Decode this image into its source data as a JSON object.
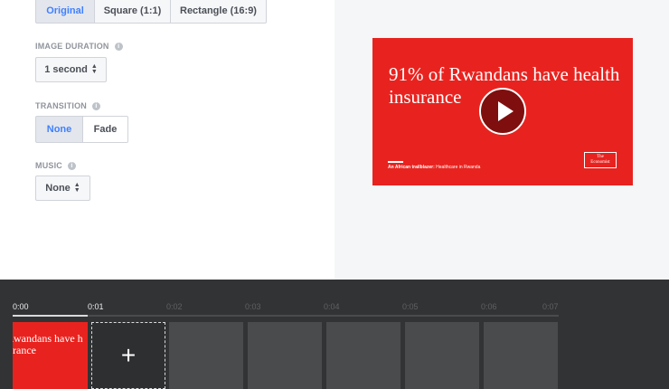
{
  "format": {
    "options": [
      "Original",
      "Square (1:1)",
      "Rectangle (16:9)"
    ],
    "selected": "Original"
  },
  "image_duration": {
    "label": "IMAGE DURATION",
    "value": "1 second"
  },
  "transition": {
    "label": "TRANSITION",
    "options": [
      "None",
      "Fade"
    ],
    "selected": "None"
  },
  "music": {
    "label": "MUSIC",
    "value": "None"
  },
  "preview": {
    "headline": "91% of Rwandans have health insurance",
    "subtitle_bold": "An African trailblazer:",
    "subtitle_rest": " Healthcare in Rwanda",
    "logo_line1": "The",
    "logo_line2": "Economist"
  },
  "timeline": {
    "ticks": [
      "0:00",
      "0:01",
      "0:02",
      "0:03",
      "0:04",
      "0:05",
      "0:06",
      "0:07"
    ],
    "thumbnail_text": "of Rwandans have h insurance",
    "add_label": "+"
  },
  "colors": {
    "accent": "#4080ff",
    "card_red": "#e8231f",
    "timeline_bg": "#323334"
  },
  "icons": {
    "info": "info-icon",
    "dropdown": "up-down-chevron-icon",
    "play": "play-icon",
    "add": "plus-icon"
  }
}
